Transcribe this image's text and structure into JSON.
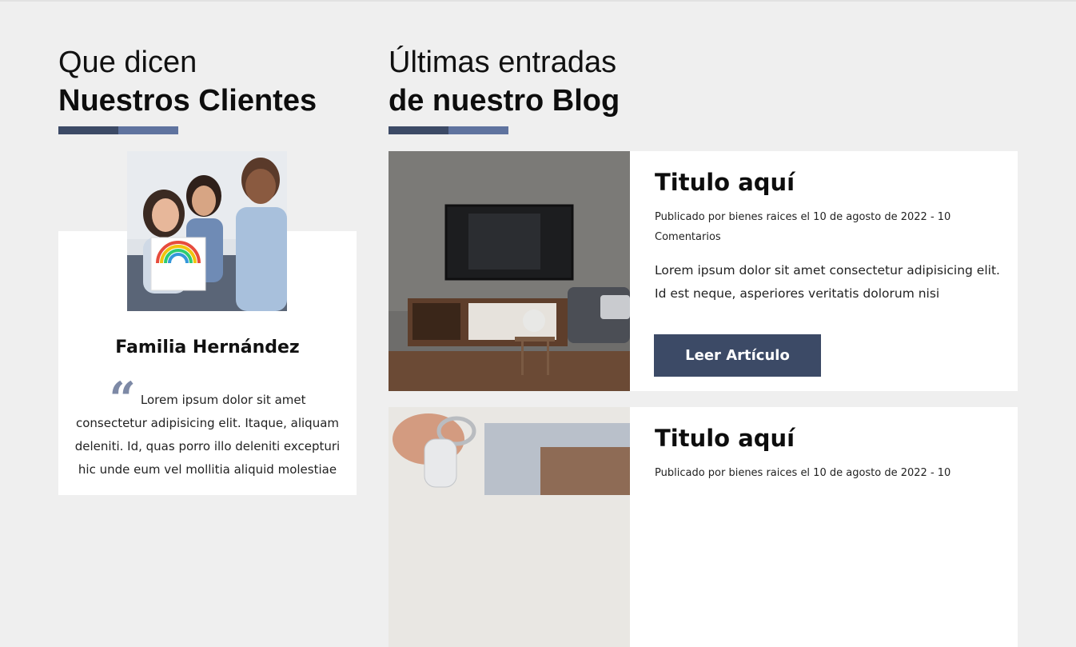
{
  "testimonials": {
    "heading_light": "Que dicen",
    "heading_bold": "Nuestros Clientes",
    "client_name": "Familia Hernández",
    "quote": "Lorem ipsum dolor sit amet consectetur adipisicing elit. Itaque, aliquam deleniti. Id, quas porro illo deleniti excepturi hic unde eum vel mollitia aliquid molestiae"
  },
  "blog": {
    "heading_light": "Últimas entradas",
    "heading_bold": "de nuestro Blog",
    "posts": [
      {
        "title": "Titulo aquí",
        "meta": "Publicado por bienes raices el 10 de agosto de 2022 - 10 Comentarios",
        "excerpt": "Lorem ipsum dolor sit amet consectetur adipisicing elit. Id est neque, asperiores veritatis dolorum nisi",
        "button": "Leer Artículo"
      },
      {
        "title": "Titulo aquí",
        "meta": "Publicado por bienes raices el 10 de agosto de 2022 - 10",
        "excerpt": "",
        "button": ""
      }
    ]
  },
  "colors": {
    "accent_dark": "#3c4a66",
    "accent_light": "#5f739f",
    "background": "#efefef"
  }
}
